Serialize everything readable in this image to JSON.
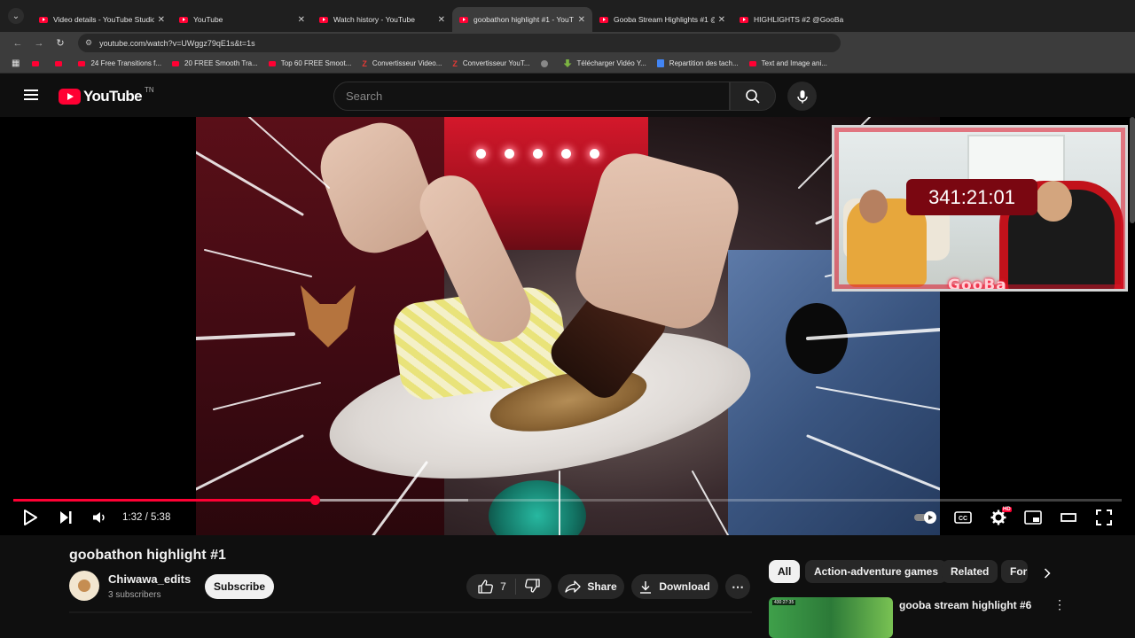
{
  "browser": {
    "tabs": [
      {
        "title": "Video details - YouTube Studio",
        "active": false
      },
      {
        "title": "YouTube",
        "active": false
      },
      {
        "title": "Watch history - YouTube",
        "active": false
      },
      {
        "title": "goobathon highlight #1 - YouT",
        "active": true
      },
      {
        "title": "Gooba Stream Highlights #1 @",
        "active": false
      },
      {
        "title": "HIGHLIGHTS #2 @GooBa",
        "active": false
      }
    ],
    "close_glyph": "✕",
    "url": "youtube.com/watch?v=UWggz79qE1s&t=1s",
    "bookmarks": [
      {
        "label": "",
        "icon": "youtube-icon"
      },
      {
        "label": "",
        "icon": "youtube-icon"
      },
      {
        "label": "24 Free Transitions f...",
        "icon": "youtube-icon"
      },
      {
        "label": "20 FREE Smooth Tra...",
        "icon": "youtube-icon"
      },
      {
        "label": "Top 60 FREE Smoot...",
        "icon": "youtube-icon"
      },
      {
        "label": "Convertisseur Video...",
        "icon": "z-icon"
      },
      {
        "label": "Convertisseur YouT...",
        "icon": "z-icon"
      },
      {
        "label": "",
        "icon": "globe-icon"
      },
      {
        "label": "Télécharger Vidéo Y...",
        "icon": "download-icon"
      },
      {
        "label": "Repartition des tach...",
        "icon": "doc-icon"
      },
      {
        "label": "Text and Image ani...",
        "icon": "youtube-icon"
      }
    ]
  },
  "header": {
    "logo_text": "YouTube",
    "region": "TN",
    "search_placeholder": "Search"
  },
  "player": {
    "current_time": "1:32",
    "duration": "5:38",
    "time_display": "1:32 / 5:38",
    "progress_fraction": 0.272,
    "buffered_fraction": 0.41,
    "overlay": {
      "badge_text": "GooBa",
      "timer": "341:21:01"
    },
    "hd_badge": "HD"
  },
  "video": {
    "title": "goobathon highlight #1",
    "channel": "Chiwawa_edits",
    "subscribers": "3 subscribers",
    "subscribe_label": "Subscribe",
    "likes": "7",
    "share_label": "Share",
    "download_label": "Download",
    "more_glyph": "⋯"
  },
  "sidebar": {
    "chips": [
      "All",
      "Action-adventure games",
      "Related",
      "For"
    ],
    "active_chip": "All",
    "recommendation": {
      "title": "gooba stream highlight #6",
      "badge": "430:27:35"
    }
  },
  "colors": {
    "accent": "#ff0033",
    "background": "#0f0f0f",
    "timer_bg": "#7a0711"
  }
}
